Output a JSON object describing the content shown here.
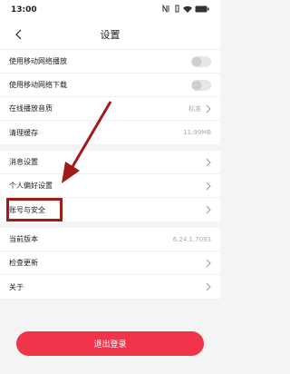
{
  "status_bar": {
    "time": "13:00",
    "battery": "100"
  },
  "header": {
    "title": "设置"
  },
  "sections": {
    "network": [
      {
        "label": "使用移动网络播放",
        "control": "toggle"
      },
      {
        "label": "使用移动网络下载",
        "control": "toggle"
      },
      {
        "label": "在线播放音质",
        "value": "标准"
      },
      {
        "label": "清理缓存",
        "value": "11.99MB"
      }
    ],
    "account": [
      {
        "label": "消息设置"
      },
      {
        "label": "个人偏好设置"
      },
      {
        "label": "账号与安全"
      }
    ],
    "about": [
      {
        "label": "当前版本",
        "value": "6.24.1.7093"
      },
      {
        "label": "检查更新"
      },
      {
        "label": "关于"
      }
    ]
  },
  "logout": {
    "label": "退出登录"
  },
  "colors": {
    "accent": "#f0354b",
    "annotation": "#a11b17"
  }
}
